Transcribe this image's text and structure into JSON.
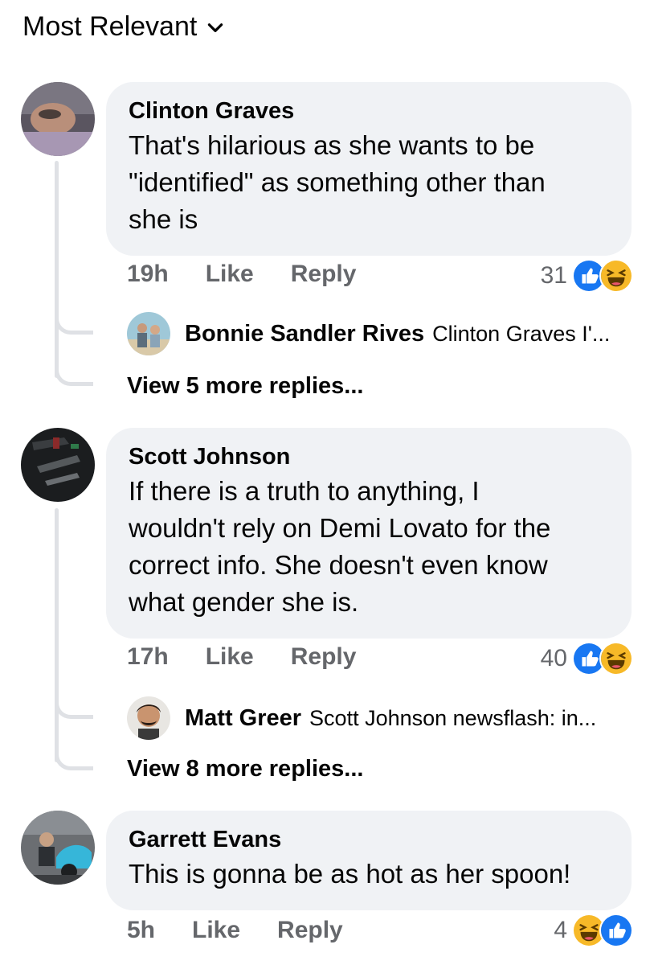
{
  "sort": {
    "label": "Most Relevant",
    "icon": "chevron-down-icon"
  },
  "comments": [
    {
      "author": "Clinton Graves",
      "text_lines": [
        "That's hilarious as she wants to be",
        "\"identified\" as something other than",
        "she is"
      ],
      "time": "19h",
      "like_label": "Like",
      "reply_label": "Reply",
      "reaction_count": "31",
      "reactions": [
        "like-icon",
        "haha-icon"
      ],
      "reply": {
        "author": "Bonnie Sandler Rives",
        "text": "Clinton Graves I'..."
      },
      "more_replies": "View 5 more replies..."
    },
    {
      "author": "Scott Johnson",
      "text_lines": [
        "If there is a truth to anything, I",
        "wouldn't rely on Demi Lovato for the",
        "correct info. She doesn't even know",
        "what gender she is."
      ],
      "time": "17h",
      "like_label": "Like",
      "reply_label": "Reply",
      "reaction_count": "40",
      "reactions": [
        "like-icon",
        "haha-icon"
      ],
      "reply": {
        "author": "Matt Greer",
        "text": "Scott Johnson newsflash: in..."
      },
      "more_replies": "View 8 more replies..."
    },
    {
      "author": "Garrett Evans",
      "text_lines": [
        "This is gonna be as hot as her spoon!"
      ],
      "time": "5h",
      "like_label": "Like",
      "reply_label": "Reply",
      "reaction_count": "4",
      "reactions": [
        "haha-icon",
        "like-icon"
      ]
    }
  ],
  "colors": {
    "bubble": "#f0f2f5",
    "meta": "#65676b",
    "like_blue": "#1877f2",
    "haha_yellow": "#f7b928"
  }
}
